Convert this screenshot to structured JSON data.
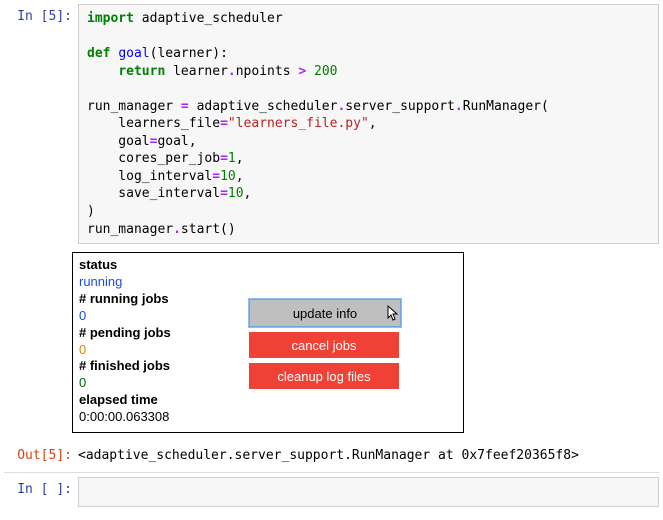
{
  "input_cell": {
    "prompt": "In [5]:",
    "code": {
      "line1a": "import",
      "line1b": " adaptive_scheduler",
      "line3a": "def",
      "line3b": " ",
      "line3c": "goal",
      "line3d": "(learner):",
      "line4a": "    ",
      "line4b": "return",
      "line4c": " learner",
      "line4d": ".",
      "line4e": "npoints ",
      "line4f": ">",
      "line4g": " ",
      "line4h": "200",
      "line6a": "run_manager ",
      "line6b": "=",
      "line6c": " adaptive_scheduler",
      "line6d": ".",
      "line6e": "server_support",
      "line6f": ".",
      "line6g": "RunManager(",
      "line7a": "    learners_file",
      "line7b": "=",
      "line7c": "\"learners_file.py\"",
      "line7d": ",",
      "line8a": "    goal",
      "line8b": "=",
      "line8c": "goal,",
      "line9a": "    cores_per_job",
      "line9b": "=",
      "line9c": "1",
      "line9d": ",",
      "line10a": "    log_interval",
      "line10b": "=",
      "line10c": "10",
      "line10d": ",",
      "line11a": "    save_interval",
      "line11b": "=",
      "line11c": "10",
      "line11d": ",",
      "line12": ")",
      "line13a": "run_manager",
      "line13b": ".",
      "line13c": "start()"
    }
  },
  "widget": {
    "status_label": "status",
    "status_value": "running",
    "running_label": "# running jobs",
    "running_value": "0",
    "pending_label": "# pending jobs",
    "pending_value": "0",
    "finished_label": "# finished jobs",
    "finished_value": "0",
    "elapsed_label": "elapsed time",
    "elapsed_value": "0:00:00.063308",
    "buttons": {
      "update": "update info",
      "cancel": "cancel jobs",
      "cleanup": "cleanup log files"
    }
  },
  "output_cell": {
    "prompt": "Out[5]:",
    "text": "<adaptive_scheduler.server_support.RunManager at 0x7feef20365f8>"
  },
  "empty_cell": {
    "prompt": "In [ ]:"
  }
}
